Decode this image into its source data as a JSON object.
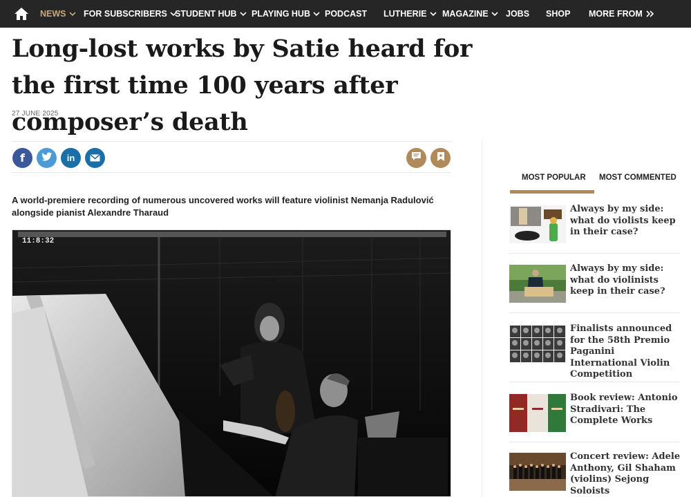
{
  "nav": {
    "items": [
      {
        "label": "NEWS",
        "has_dropdown": true,
        "active": true
      },
      {
        "label": "FOR SUBSCRIBERS",
        "has_dropdown": true
      },
      {
        "label": "STUDENT HUB",
        "has_dropdown": true
      },
      {
        "label": "PLAYING HUB",
        "has_dropdown": true
      },
      {
        "label": "PODCAST",
        "has_dropdown": false
      },
      {
        "label": "LUTHERIE",
        "has_dropdown": true
      },
      {
        "label": "MAGAZINE",
        "has_dropdown": true
      },
      {
        "label": "JOBS",
        "has_dropdown": false
      },
      {
        "label": "SHOP",
        "has_dropdown": false
      },
      {
        "label": "MORE FROM",
        "has_dropdown": false
      }
    ],
    "home_icon": "home-icon",
    "more_icon": "double-chevron-right-icon"
  },
  "article": {
    "headline": "Long-lost works by Satie heard for the first time 100 years after composer’s death",
    "date": "27 JUNE 2025",
    "standfirst": "A world-premiere recording of numerous uncovered works will feature violinist Nemanja Radulović alongside pianist Alexandre Tharaud",
    "image_timestamp": "11:8:32",
    "share": {
      "facebook": "f",
      "twitter_icon": "twitter-bird-icon",
      "linkedin": "in",
      "email_icon": "envelope-icon"
    },
    "tools": {
      "comment_icon": "comment-icon",
      "bookmark_icon": "bookmark-icon"
    }
  },
  "sidebar": {
    "tabs": [
      "MOST POPULAR",
      "MOST COMMENTED"
    ],
    "items": [
      {
        "title": "Always by my side: what do violists keep in their case?"
      },
      {
        "title": "Always by my side: what do violinists keep in their case?"
      },
      {
        "title": "Finalists announced for the 58th Premio Paganini International Violin Competition"
      },
      {
        "title": "Book review: Antonio Stradivari: The Complete Works"
      },
      {
        "title": "Concert review: Adele Anthony, Gil Shaham (violins) Sejong Soloists"
      }
    ]
  },
  "colors": {
    "nav_bg": "#262626",
    "accent": "#b08a5a",
    "nav_active": "#c8a97a",
    "facebook": "#3b5998",
    "twitter": "#4d9bd6",
    "linkedin": "#1b6fa8"
  }
}
